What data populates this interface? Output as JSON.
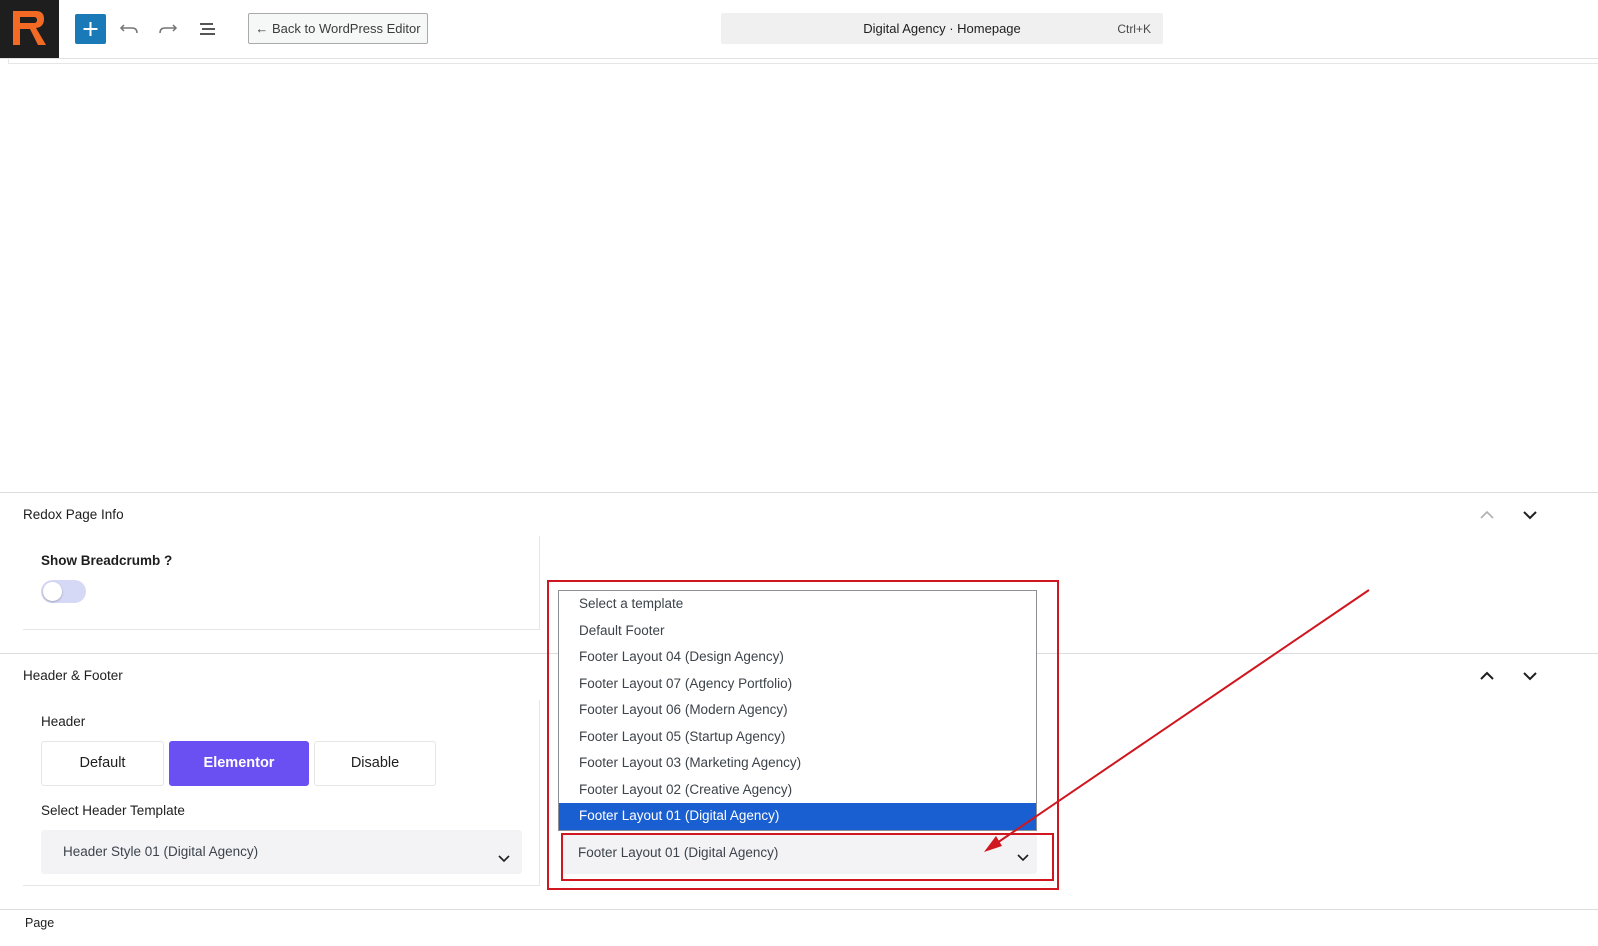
{
  "toolbar": {
    "back_label": "← Back to WordPress Editor",
    "document_title": "Digital Agency · Homepage",
    "shortcut": "Ctrl+K"
  },
  "redox_panel": {
    "title": "Redox Page Info",
    "breadcrumb_label": "Show Breadcrumb ?",
    "breadcrumb_enabled": false
  },
  "hf_panel": {
    "title": "Header & Footer",
    "header_label": "Header",
    "header_options": [
      "Default",
      "Elementor",
      "Disable"
    ],
    "header_selected": "Elementor",
    "select_header_label": "Select Header Template",
    "header_template_value": "Header Style 01 (Digital Agency)",
    "footer_options": [
      "Select a template",
      "Default Footer",
      "Footer Layout 04 (Design Agency)",
      "Footer Layout 07 (Agency Portfolio)",
      "Footer Layout 06 (Modern Agency)",
      "Footer Layout 05 (Startup Agency)",
      "Footer Layout 03 (Marketing Agency)",
      "Footer Layout 02 (Creative Agency)",
      "Footer Layout 01 (Digital Agency)"
    ],
    "footer_selected_index": 8,
    "footer_template_value": "Footer Layout 01 (Digital Agency)"
  },
  "status_bar": {
    "breadcrumb": "Page"
  },
  "colors": {
    "accent_purple": "#6a4ff3",
    "wp_blue": "#1a7ab8",
    "selected_option": "#1a5fd1",
    "annotation_red": "#d0161e"
  }
}
